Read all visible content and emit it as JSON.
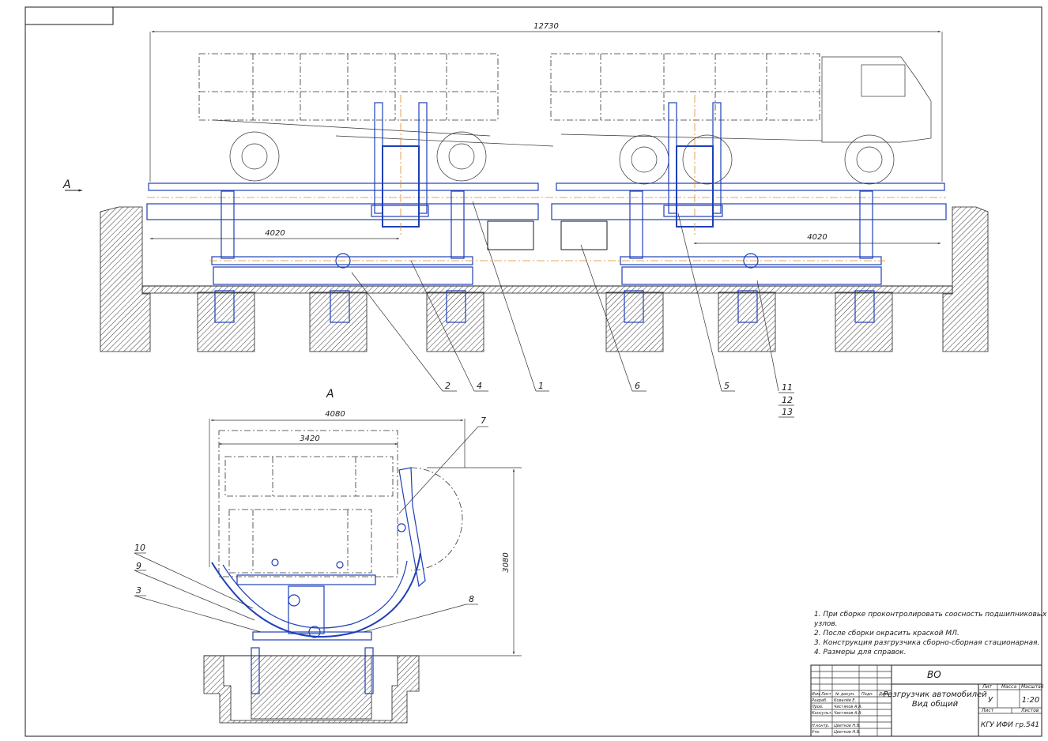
{
  "dimensions": {
    "overall_length": "12730",
    "span_left": "4020",
    "span_right": "4020",
    "section_width_outer": "4080",
    "section_width_inner": "3420",
    "section_height": "3080"
  },
  "view_label": "А",
  "section_label": "А",
  "callouts": [
    "1",
    "2",
    "3",
    "4",
    "5",
    "6",
    "7",
    "8",
    "9",
    "10",
    "11",
    "12",
    "13"
  ],
  "notes": [
    "1. При сборке проконтролировать соосность подшипниковых",
    "узлов.",
    "2. После сборки окрасить краской МЛ.",
    "3. Конструкция разгрузчика сборно-сборная стационарная.",
    "4. Размеры для справок."
  ],
  "title_block": {
    "designation": "ВО",
    "title_line1": "Разгрузчик автомобилей",
    "title_line2": "Вид общий",
    "lit_header": "Лит",
    "mass_header": "Масса",
    "scale_header": "Масштаб",
    "lit_value": "У",
    "scale": "1:20",
    "sheet_label": "Лист",
    "sheets_label": "Листов",
    "org": "КГУ ИФИ  гр.541",
    "row_headers": [
      "Изм.",
      "Лист",
      "№ докум.",
      "Подп.",
      "Дата"
    ],
    "roles": [
      "Разраб.",
      "Пров.",
      "Консульт.",
      "Н.контр.",
      "Утв."
    ],
    "names": [
      "Ковалёв Е.",
      "Чистяков А.А.",
      "Чистяков А.А.",
      "Цветков Н.В.",
      "Цветков Н.В."
    ]
  }
}
